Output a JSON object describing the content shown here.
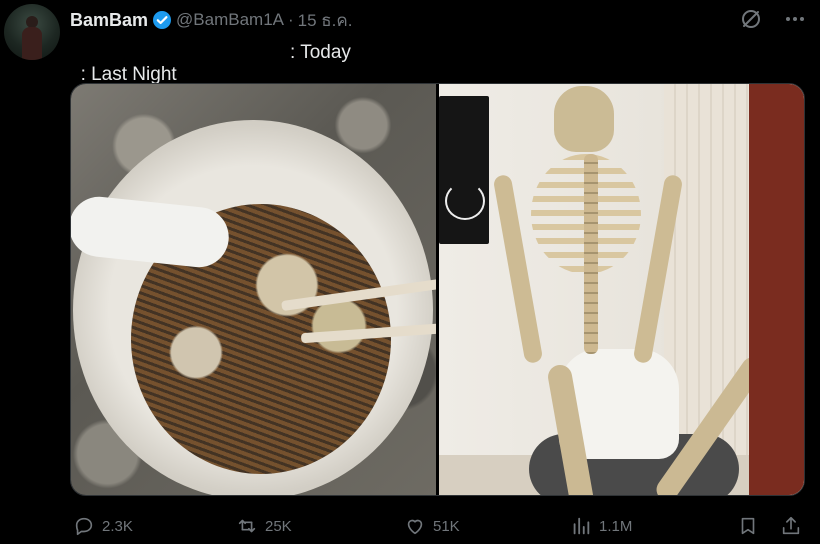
{
  "author": {
    "display_name": "BamBam",
    "handle": "@BamBam1A",
    "separator": "·",
    "date": "15 ธ.ค."
  },
  "tweet": {
    "text_left": ": Last Night",
    "text_right": ": Today"
  },
  "media": {
    "left_alt": "",
    "right_alt": ""
  },
  "actions": {
    "replies": "2.3K",
    "retweets": "25K",
    "likes": "51K",
    "views": "1.1M"
  },
  "colors": {
    "background": "#000000",
    "text": "#e7e9ea",
    "muted": "#71767b",
    "verified": "#1d9bf0"
  },
  "icons": {
    "verified": "verified-badge-icon",
    "grok": "grok-slash-icon",
    "more": "more-dots-icon",
    "reply": "reply-icon",
    "retweet": "retweet-icon",
    "like": "heart-icon",
    "views": "views-bars-icon",
    "bookmark": "bookmark-icon",
    "share": "share-icon"
  }
}
